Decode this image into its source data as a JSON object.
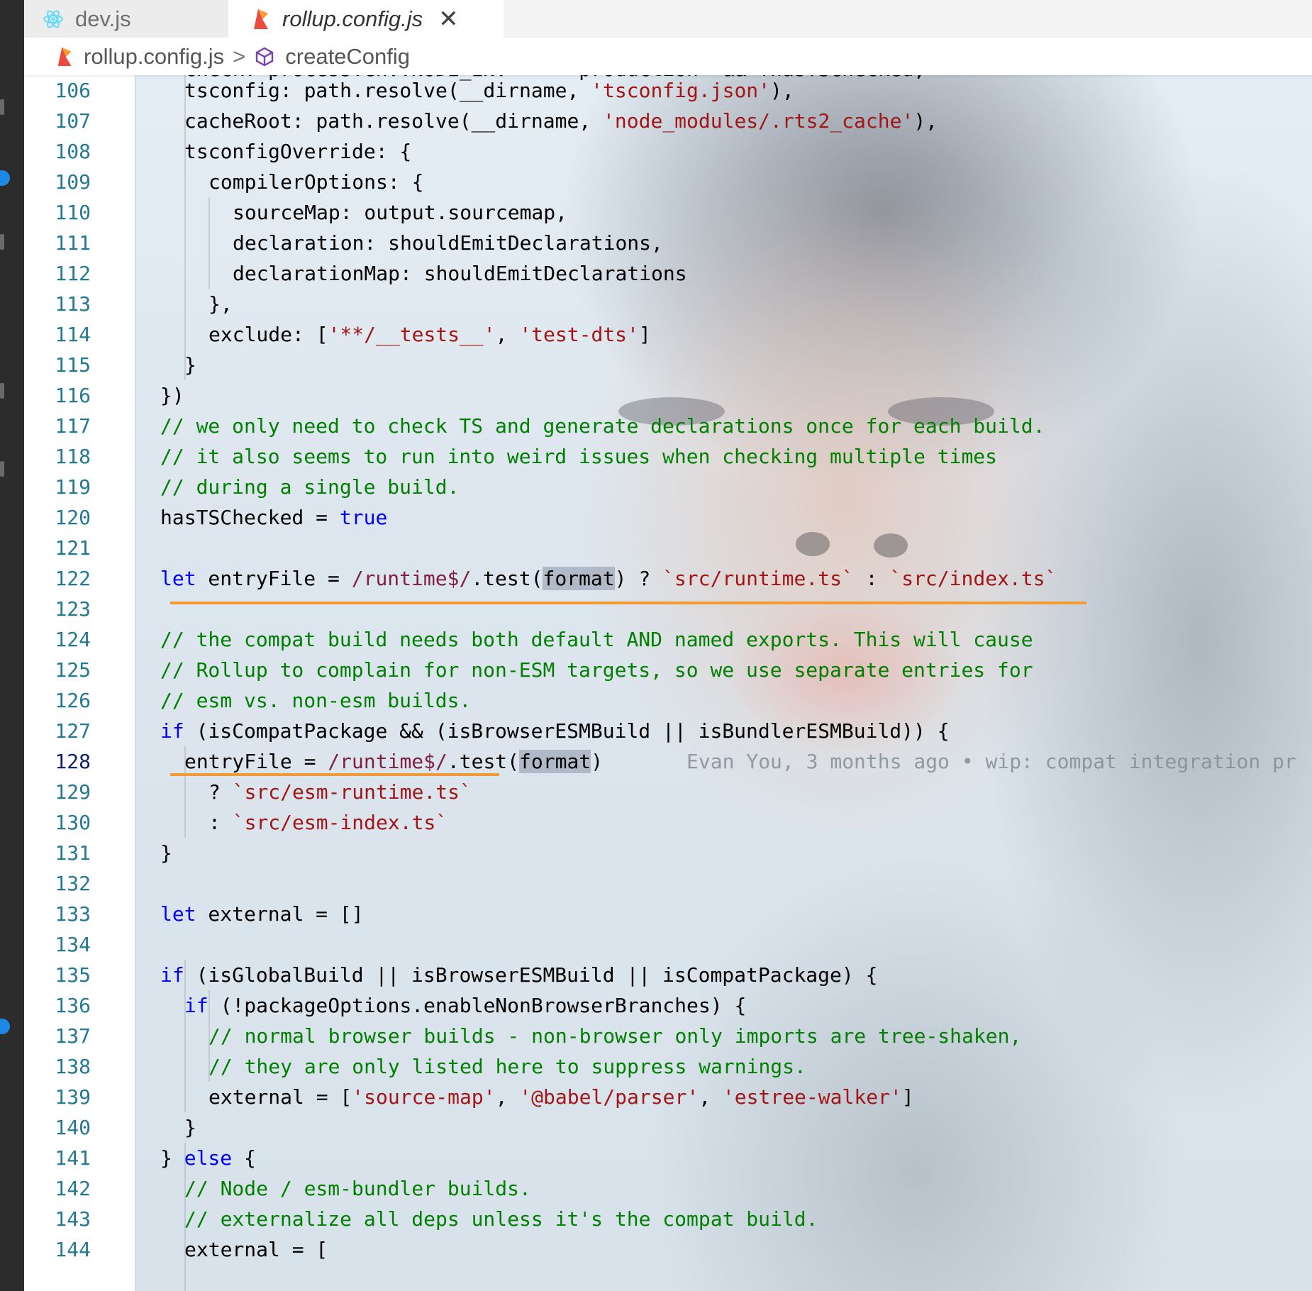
{
  "tabs": [
    {
      "label": "dev.js",
      "icon": "react-icon",
      "active": false
    },
    {
      "label": "rollup.config.js",
      "icon": "rollup-icon",
      "active": true,
      "close_glyph": "✕"
    }
  ],
  "breadcrumb": {
    "file": "rollup.config.js",
    "separator": ">",
    "symbol": "createConfig",
    "symbol_icon": "cube-icon"
  },
  "editor": {
    "current_line": 128,
    "line_numbers": [
      "106",
      "107",
      "108",
      "109",
      "110",
      "111",
      "112",
      "113",
      "114",
      "115",
      "116",
      "117",
      "118",
      "119",
      "120",
      "121",
      "122",
      "123",
      "124",
      "125",
      "126",
      "127",
      "128",
      "129",
      "130",
      "131",
      "132",
      "133",
      "134",
      "135",
      "136",
      "137",
      "138",
      "139",
      "140",
      "141",
      "142",
      "143",
      "144"
    ],
    "partial_top_line": "check: process.env.NODE_ENV === 'production' && !hasTSChecked,",
    "lines": {
      "l106": {
        "a": "tsconfig: path.resolve(__dirname, ",
        "s": "'tsconfig.json'",
        "b": "),"
      },
      "l107": {
        "a": "cacheRoot: path.resolve(__dirname, ",
        "s": "'node_modules/.rts2_cache'",
        "b": "),"
      },
      "l108": "tsconfigOverride: {",
      "l109": "compilerOptions: {",
      "l110": "sourceMap: output.sourcemap,",
      "l111": "declaration: shouldEmitDeclarations,",
      "l112": "declarationMap: shouldEmitDeclarations",
      "l113": "},",
      "l114": {
        "a": "exclude: [",
        "s1": "'**/__tests__'",
        "b": ", ",
        "s2": "'test-dts'",
        "c": "]"
      },
      "l115": "}",
      "l116": "})",
      "l117": "// we only need to check TS and generate declarations once for each build.",
      "l118": "// it also seems to run into weird issues when checking multiple times",
      "l119": "// during a single build.",
      "l120": {
        "a": "hasTSChecked = ",
        "kw": "true"
      },
      "l122": {
        "kw": "let",
        "a": " entryFile = ",
        "re": "/runtime$/",
        "b": ".test(",
        "hl": "format",
        "c": ") ? ",
        "s1": "`src/runtime.ts`",
        "d": " : ",
        "s2": "`src/index.ts`"
      },
      "l124": "// the compat build needs both default AND named exports. This will cause",
      "l125": "// Rollup to complain for non-ESM targets, so we use separate entries for",
      "l126": "// esm vs. non-esm builds.",
      "l127": {
        "kw": "if",
        "a": " (isCompatPackage && (isBrowserESMBuild || isBundlerESMBuild)) {"
      },
      "l128": {
        "a": "entryFile = ",
        "re": "/runtime$/",
        "b": ".test(",
        "hl": "format",
        "c": ")",
        "blame": "Evan You, 3 months ago • wip: compat integration pr"
      },
      "l129": {
        "a": "? ",
        "s": "`src/esm-runtime.ts`"
      },
      "l130": {
        "a": ": ",
        "s": "`src/esm-index.ts`"
      },
      "l131": "}",
      "l133": {
        "kw": "let",
        "a": " external = []"
      },
      "l135": {
        "kw": "if",
        "a": " (isGlobalBuild || isBrowserESMBuild || isCompatPackage) {"
      },
      "l136": {
        "kw": "if",
        "a": " (!packageOptions.enableNonBrowserBranches) {"
      },
      "l137": "// normal browser builds - non-browser only imports are tree-shaken,",
      "l138": "// they are only listed here to suppress warnings.",
      "l139": {
        "a": "external = [",
        "s1": "'source-map'",
        "b": ", ",
        "s2": "'@babel/parser'",
        "c": ", ",
        "s3": "'estree-walker'",
        "d": "]"
      },
      "l140": "}",
      "l141": {
        "a": "} ",
        "kw": "else",
        "b": " {"
      },
      "l142": "// Node / esm-bundler builds.",
      "l143": "// externalize all deps unless it's the compat build.",
      "l144": "external = ["
    }
  },
  "colors": {
    "string": "#a31515",
    "comment": "#008000",
    "keyword": "#0000ff",
    "regex": "#811f3f",
    "line_number": "#237893",
    "underline": "#f29a33"
  }
}
